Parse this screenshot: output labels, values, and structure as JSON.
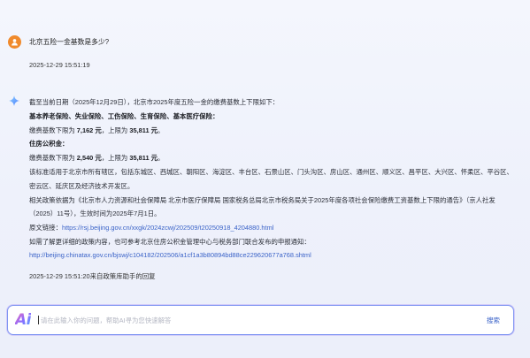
{
  "user": {
    "question": "北京五险一金基数是多少?",
    "time": "2025-12-29 15:51:19"
  },
  "answer": {
    "intro": "截至当前日期（2025年12月29日），北京市2025年度五险一金的缴费基数上下限如下：",
    "social_title": "基本养老保险、失业保险、工伤保险、生育保险、基本医疗保险：",
    "social_pre": "缴费基数下限为 ",
    "social_low": "7,162 元",
    "social_mid": "，上限为 ",
    "social_high": "35,811 元",
    "social_end": "。",
    "fund_title": "住房公积金：",
    "fund_pre": "缴费基数下限为 ",
    "fund_low": "2,540 元",
    "fund_mid": "，上限为 ",
    "fund_high": "35,811 元",
    "fund_end": "。",
    "scope_1": "该标准适用于北京市所有辖区，包括东城区、西城区、朝阳区、海淀区、丰台区、石景山区、门头沟区、房山区、通州区、顺义区、昌平区、大兴区、怀柔区、平谷区、",
    "scope_2": "密云区、延庆区及经济技术开发区。",
    "basis_1": "相关政策依据为《北京市人力资源和社会保障局 北京市医疗保障局 国家税务总局北京市税务局关于2025年度各项社会保险缴费工资基数上下限的通告》（京人社发",
    "basis_2": "（2025）11号），生效时间为2025年7月1日。",
    "source_label": "原文链接：",
    "source_url": "https://rsj.beijing.gov.cn/xxgk/2024zcwj/202509/t20250918_4204880.html",
    "more": "如需了解更详细的政策内容，也可参考北京住房公积金管理中心与税务部门联合发布的申报通知：",
    "more_url": "http://beijing.chinatax.gov.cn/bjswj/c104182/202506/a1cf1a3b80894bd88ce229620677a768.shtml"
  },
  "signature": "2025-12-29 15:51:20来自政策库助手的回复",
  "input": {
    "logo": "Ai",
    "placeholder": "请在此输入你的问题，帮助AI寻为您快速解答",
    "search_label": "搜索"
  },
  "colors": {
    "accent": "#3b63c8",
    "avatar": "#f08a2c",
    "input_border": "#7f96f2"
  },
  "icons": {
    "user_avatar": "person-icon",
    "ai_avatar": "sparkle-icon"
  }
}
